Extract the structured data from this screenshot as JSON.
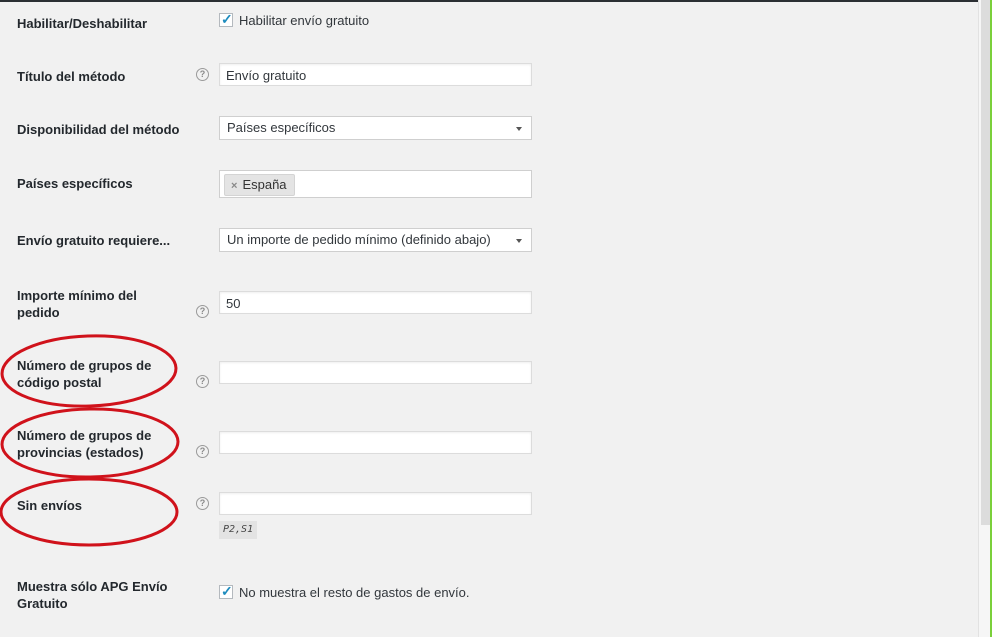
{
  "fields": {
    "enable": {
      "label": "Habilitar/Deshabilitar",
      "checkbox_label": "Habilitar envío gratuito",
      "checked": true
    },
    "title": {
      "label": "Título del método",
      "value": "Envío gratuito"
    },
    "availability": {
      "label": "Disponibilidad del método",
      "selected": "Países específicos"
    },
    "countries": {
      "label": "Países específicos",
      "chips": [
        "España"
      ],
      "remove_glyph": "×"
    },
    "requires": {
      "label": "Envío gratuito requiere...",
      "selected": "Un importe de pedido mínimo (definido abajo)"
    },
    "min_amount": {
      "label_line1": "Importe mínimo del",
      "label_line2": "pedido",
      "value": "50"
    },
    "postcode_groups": {
      "label_line1": "Número de grupos de",
      "label_line2": "código postal",
      "value": ""
    },
    "state_groups": {
      "label_line1": "Número de grupos de",
      "label_line2": "provincias (estados)",
      "value": ""
    },
    "no_shipping": {
      "label": "Sin envíos",
      "value": "",
      "hint": "P2,S1"
    },
    "only_apg": {
      "label_line1": "Muestra sólo APG Envío",
      "label_line2": "Gratuito",
      "checkbox_label": "No muestra el resto de gastos de envío.",
      "checked": true
    }
  },
  "help_glyph": "?",
  "check_glyph": "✓",
  "colors": {
    "annotation": "#d0121b",
    "accent": "#7ad03a",
    "checkmark": "#1e8cbe"
  }
}
